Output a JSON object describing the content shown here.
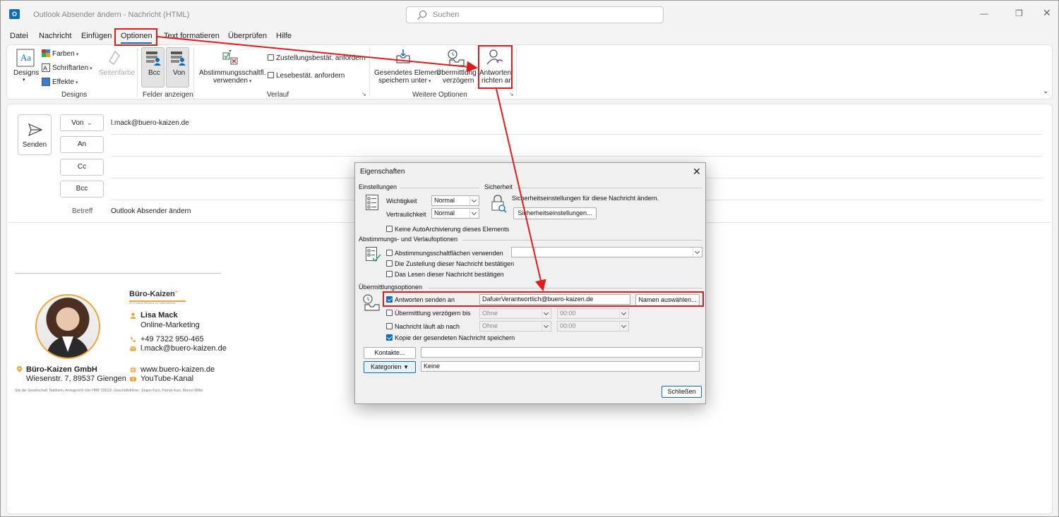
{
  "window": {
    "title": "Outlook Absender ändern  -  Nachricht (HTML)",
    "search_placeholder": "Suchen",
    "app_icon": "O"
  },
  "menu": [
    "Datei",
    "Nachricht",
    "Einfügen",
    "Optionen",
    "Text formatieren",
    "Überprüfen",
    "Hilfe"
  ],
  "ribbon": {
    "designs": {
      "designs": "Designs",
      "farben": "Farben",
      "schriftarten": "Schriftarten",
      "effekte": "Effekte",
      "seitenfarbe": "Seitenfarbe",
      "group": "Designs"
    },
    "felder": {
      "bcc": "Bcc",
      "von": "Von",
      "group": "Felder anzeigen"
    },
    "verlauf": {
      "abstimmung_1": "Abstimmungsschaltfl.",
      "abstimmung_2": "verwenden",
      "zustellung": "Zustellungsbestät. anfordern",
      "lese": "Lesebestät. anfordern",
      "group": "Verlauf"
    },
    "weitere": {
      "gesendet_1": "Gesendetes Element",
      "gesendet_2": "speichern unter",
      "verz_1": "Übermittlung",
      "verz_2": "verzögern",
      "antw_1": "Antworten",
      "antw_2": "richten an",
      "group": "Weitere Optionen"
    }
  },
  "compose": {
    "send": "Senden",
    "von": "Von",
    "an": "An",
    "cc": "Cc",
    "bcc": "Bcc",
    "from_value": "l.mack@buero-kaizen.de",
    "subject_label": "Betreff",
    "subject_value": "Outlook Absender ändern"
  },
  "signature": {
    "logo": "Büro-Kaizen",
    "tagline": "20 % mehr Effizienz im Unternehmen",
    "name": "Lisa Mack",
    "role": "Online-Marketing",
    "phone": "+49 7322 950-465",
    "email": "l.mack@buero-kaizen.de",
    "company": "Büro-Kaizen GmbH",
    "address": "Wiesenstr. 7, 89537 Giengen",
    "web": "www.buero-kaizen.de",
    "youtube": "YouTube-Kanal",
    "footer": "Sitz der Gesellschaft: Nattheim, Amtsgericht Ulm HRB 728116, Geschäftsführer: Jürgen Kurz, Patrick Kurz, Marcel Miller",
    "accent": "#f0a43a"
  },
  "dialog": {
    "title": "Eigenschaften",
    "einstellungen": "Einstellungen",
    "sicherheit": "Sicherheit",
    "wichtigkeit_label": "Wichtigkeit",
    "wichtigkeit_value": "Normal",
    "vertraulichkeit_label": "Vertraulichkeit",
    "vertraulichkeit_value": "Normal",
    "sicherheit_text": "Sicherheitseinstellungen für diese Nachricht ändern.",
    "sicherheit_btn": "Sicherheitseinstellungen...",
    "keine_auto": "Keine AutoArchivierung dieses Elements",
    "abstimmung_sec": "Abstimmungs- und Verlaufoptionen",
    "abstimmung_cb": "Abstimmungsschaltflächen verwenden",
    "zustellung_cb": "Die Zustellung dieser Nachricht bestätigen",
    "lesen_cb": "Das Lesen dieser Nachricht bestätigen",
    "uebermittlung_sec": "Übermittlungsoptionen",
    "antworten_cb": "Antworten senden an",
    "antworten_value": "DafuerVerantwortlich@buero-kaizen.de",
    "namen_btn": "Namen auswählen...",
    "verzoegern_cb": "Übermittlung verzögern bis",
    "ohne_1": "Ohne",
    "time_1": "00:00",
    "ablauf_cb": "Nachricht läuft ab nach",
    "ohne_2": "Ohne",
    "time_2": "00:00",
    "kopie_cb": "Kopie der gesendeten Nachricht speichern",
    "kontakte_btn": "Kontakte...",
    "kategorien_btn": "Kategorien",
    "kategorien_value": "Keine",
    "schliessen_btn": "Schließen"
  },
  "colors": {
    "accent": "#0f6cbd",
    "highlight": "#e01b1b"
  }
}
